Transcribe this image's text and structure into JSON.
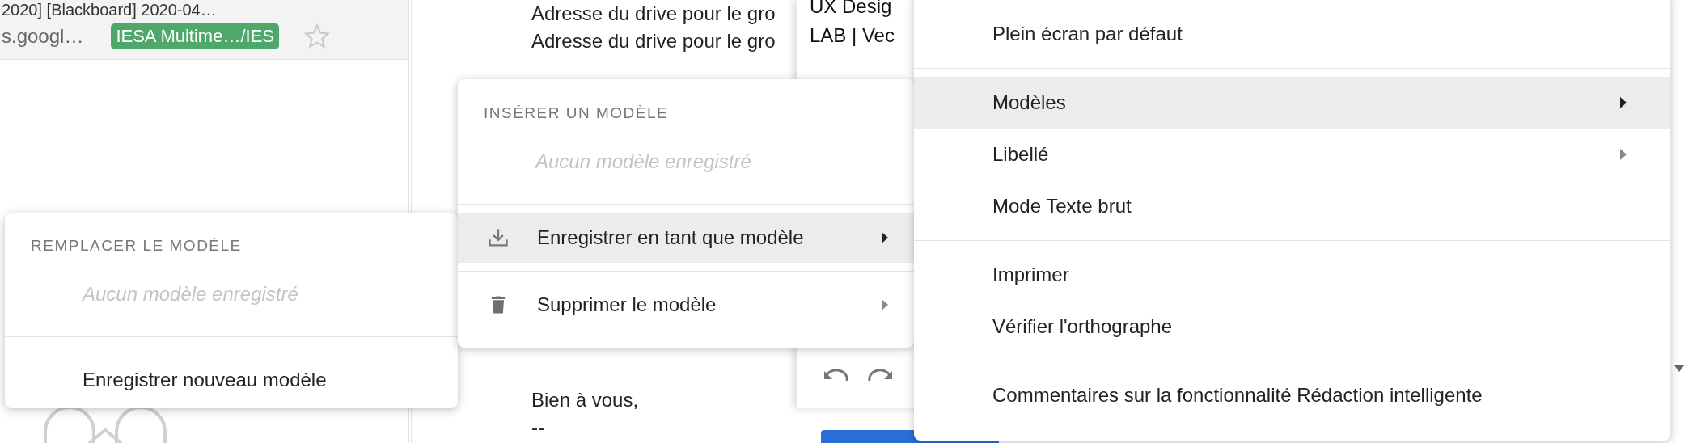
{
  "inbox_row": {
    "subject": "2020] [Blackboard] 2020-04…",
    "snippet": "s.googl…",
    "tag": {
      "label": "IESA Multime…/IES",
      "color": "#4ea86a"
    },
    "starred": false
  },
  "email_body": {
    "lines": [
      "Adresse du drive pour le gro",
      "Adresse du drive pour le gro"
    ],
    "closing": [
      "Bien à vous,",
      "--"
    ]
  },
  "compose": {
    "lines": [
      "UX Desig",
      "LAB | Vec"
    ]
  },
  "more_menu": {
    "items": [
      {
        "kind": "item",
        "label": "Plein écran par défaut",
        "selected": false,
        "submenu": false
      },
      {
        "kind": "divider"
      },
      {
        "kind": "item",
        "label": "Modèles",
        "selected": true,
        "submenu": true
      },
      {
        "kind": "item",
        "label": "Libellé",
        "selected": false,
        "submenu": true
      },
      {
        "kind": "item",
        "label": "Mode Texte brut",
        "selected": false,
        "submenu": false
      },
      {
        "kind": "divider"
      },
      {
        "kind": "item",
        "label": "Imprimer",
        "selected": false,
        "submenu": false
      },
      {
        "kind": "item",
        "label": "Vérifier l'orthographe",
        "selected": false,
        "submenu": false
      },
      {
        "kind": "divider"
      },
      {
        "kind": "item",
        "label": "Commentaires sur la fonctionnalité Rédaction intelligente",
        "selected": false,
        "submenu": false
      }
    ]
  },
  "templates_menu": {
    "header": "INSÉRER UN MODÈLE",
    "empty": "Aucun modèle enregistré",
    "items": [
      {
        "label": "Enregistrer en tant que modèle",
        "selected": true
      },
      {
        "label": "Supprimer le modèle",
        "selected": false
      }
    ]
  },
  "replace_menu": {
    "header": "REMPLACER LE MODÈLE",
    "empty": "Aucun modèle enregistré",
    "items": [
      {
        "label": "Enregistrer nouveau modèle",
        "selected": false
      }
    ]
  }
}
